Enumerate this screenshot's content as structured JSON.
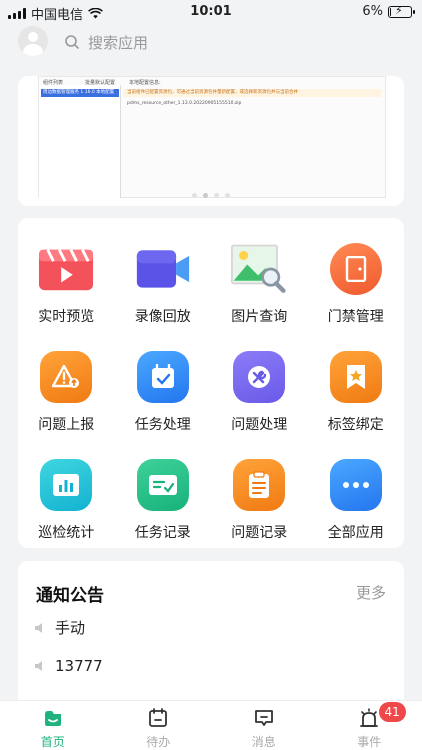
{
  "status_bar": {
    "carrier": "中国电信",
    "time": "10:01",
    "battery": "6%",
    "battery_level": 0.06
  },
  "header": {
    "search_placeholder": "搜索应用"
  },
  "banner": {
    "screenshot_texts": {
      "col1": "组件列表",
      "col2": "批量默认配置",
      "col3": "本地配置信息:",
      "selected_row": "周边数据管理服务 1.16.0  本地配置",
      "warning": "当前组件已配置资源包，可通过当前资源包并量新配置，或选择新资源包并与当前合并",
      "file": "pdms_resource_other_1.13.0.20220905155510.zip"
    },
    "page_count": 4,
    "active_index": 1
  },
  "apps": [
    {
      "label": "实时预览",
      "icon": "video-play-icon"
    },
    {
      "label": "录像回放",
      "icon": "video-camera-icon"
    },
    {
      "label": "图片查询",
      "icon": "image-search-icon"
    },
    {
      "label": "门禁管理",
      "icon": "door-icon"
    },
    {
      "label": "问题上报",
      "icon": "warning-upload-icon"
    },
    {
      "label": "任务处理",
      "icon": "calendar-check-icon"
    },
    {
      "label": "问题处理",
      "icon": "tools-icon"
    },
    {
      "label": "标签绑定",
      "icon": "tag-star-icon"
    },
    {
      "label": "巡检统计",
      "icon": "bar-chart-icon"
    },
    {
      "label": "任务记录",
      "icon": "task-record-icon"
    },
    {
      "label": "问题记录",
      "icon": "clipboard-icon"
    },
    {
      "label": "全部应用",
      "icon": "more-dots-icon"
    }
  ],
  "notice": {
    "title": "通知公告",
    "more": "更多",
    "items": [
      {
        "text": "手动"
      },
      {
        "text": "13777"
      }
    ]
  },
  "tabs": [
    {
      "label": "首页",
      "icon": "home-icon",
      "active": true
    },
    {
      "label": "待办",
      "icon": "todo-icon",
      "active": false
    },
    {
      "label": "消息",
      "icon": "message-icon",
      "active": false
    },
    {
      "label": "事件",
      "icon": "event-icon",
      "active": false,
      "badge": "41"
    }
  ],
  "colors": {
    "accent": "#1fb37e",
    "badge": "#f04848"
  }
}
